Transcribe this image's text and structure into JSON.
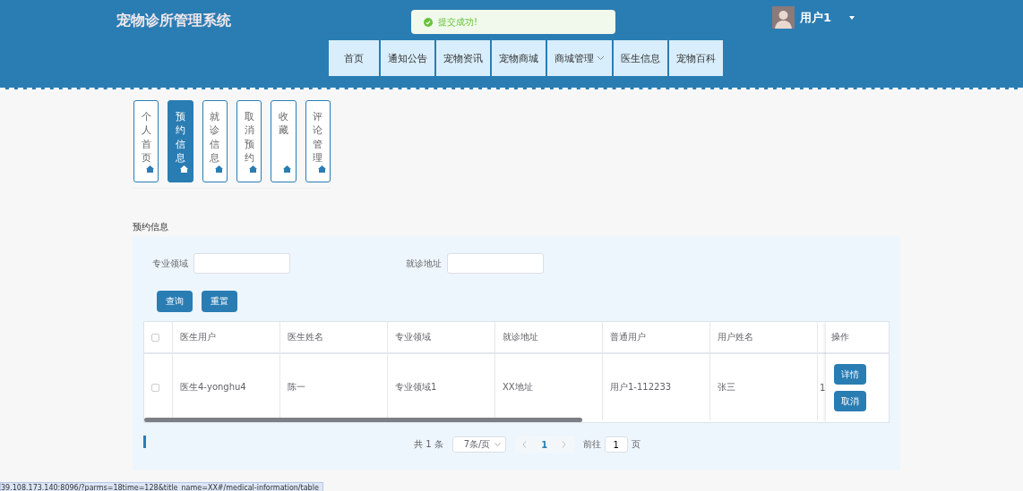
{
  "header": {
    "title": "宠物诊所管理系统",
    "user": "用户1",
    "toast": "提交成功!"
  },
  "nav": [
    {
      "label": "首页",
      "dropdown": false
    },
    {
      "label": "通知公告",
      "dropdown": false
    },
    {
      "label": "宠物资讯",
      "dropdown": false
    },
    {
      "label": "宠物商城",
      "dropdown": false
    },
    {
      "label": "商城管理",
      "dropdown": true
    },
    {
      "label": "医生信息",
      "dropdown": false
    },
    {
      "label": "宠物百科",
      "dropdown": false
    }
  ],
  "side_tabs": [
    {
      "label": "个人首页",
      "selected": false
    },
    {
      "label": "预约信息",
      "selected": true
    },
    {
      "label": "就诊信息",
      "selected": false
    },
    {
      "label": "取消预约",
      "selected": false
    },
    {
      "label": "收藏",
      "selected": false
    },
    {
      "label": "评论管理",
      "selected": false
    }
  ],
  "section_title": "预约信息",
  "search": [
    {
      "label": "专业领域"
    },
    {
      "label": "就诊地址"
    }
  ],
  "buttons": [
    "查询",
    "重置"
  ],
  "table": {
    "columns": [
      "医生用户",
      "医生姓名",
      "专业领域",
      "就诊地址",
      "普通用户",
      "用户姓名"
    ],
    "action_column": "操作",
    "all_checked": false,
    "rows": [
      {
        "checked": false,
        "cells": [
          "医生4-yonghu4",
          "陈一",
          "专业领域1",
          "XX地址",
          "用户1-112233",
          "张三",
          "1"
        ],
        "actions": [
          "详情",
          "取消"
        ]
      }
    ]
  },
  "pagination": {
    "total": "共 1 条",
    "page_size": "7条/页",
    "current": "1",
    "goto_label": "前往",
    "goto_value": "1",
    "page_unit": "页"
  },
  "status_url": "39.108.173.140:8096/?parms=18time=128&title_name=XX#/medical-information/table"
}
